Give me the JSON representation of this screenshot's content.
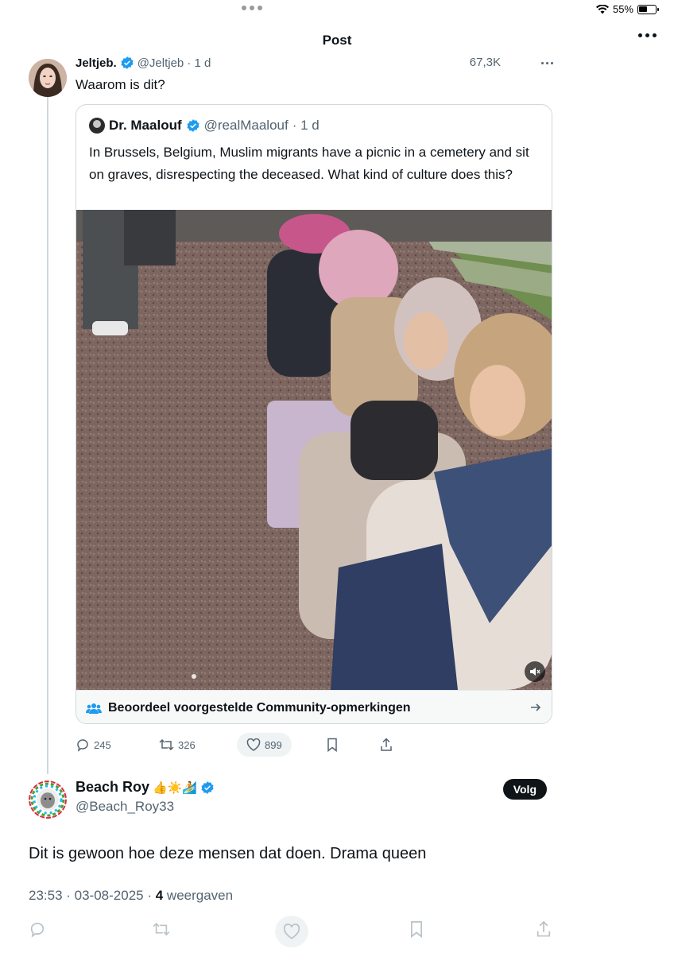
{
  "status": {
    "battery": "55%",
    "battery_level": 0.55
  },
  "header": {
    "title": "Post"
  },
  "parent": {
    "name": "Jeltjeb.",
    "handle": "@Jeltjeb",
    "time": "· 1 d",
    "views": "67,3K",
    "text": "Waarom is dit?"
  },
  "quote": {
    "name": "Dr. Maalouf",
    "handle": "@realMaalouf",
    "time": "· 1 d",
    "text": "In Brussels, Belgium, Muslim migrants have a picnic in a cemetery and sit on graves, disrespecting the deceased. What kind of culture does this?",
    "community_label": "Beoordeel voorgestelde Community-opmerkingen"
  },
  "actions": {
    "replies": "245",
    "reposts": "326",
    "likes": "899"
  },
  "reply": {
    "name": "Beach Roy",
    "emoji": "👍☀️🏄",
    "handle": "@Beach_Roy33",
    "follow_label": "Volg",
    "text": "Dit is gewoon hoe deze mensen dat doen. Drama queen",
    "time": "23:53 · 03-08-2025 · ",
    "views_count": "4",
    "views_label": " weergaven"
  },
  "colors": {
    "verified": "#1d9bf0",
    "accent": "#0f1419",
    "secondary": "#536471"
  },
  "icons": [
    "wifi-icon",
    "battery-icon",
    "more-icon",
    "verified-icon",
    "community-icon",
    "arrow-right-icon",
    "mute-icon",
    "reply-icon",
    "repost-icon",
    "like-icon",
    "bookmark-icon",
    "share-icon"
  ]
}
